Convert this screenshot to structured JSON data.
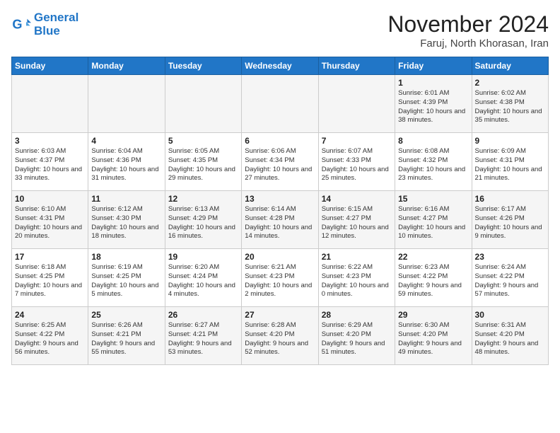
{
  "header": {
    "logo_line1": "General",
    "logo_line2": "Blue",
    "month_year": "November 2024",
    "location": "Faruj, North Khorasan, Iran"
  },
  "days_of_week": [
    "Sunday",
    "Monday",
    "Tuesday",
    "Wednesday",
    "Thursday",
    "Friday",
    "Saturday"
  ],
  "weeks": [
    [
      {
        "num": "",
        "info": ""
      },
      {
        "num": "",
        "info": ""
      },
      {
        "num": "",
        "info": ""
      },
      {
        "num": "",
        "info": ""
      },
      {
        "num": "",
        "info": ""
      },
      {
        "num": "1",
        "info": "Sunrise: 6:01 AM\nSunset: 4:39 PM\nDaylight: 10 hours and 38 minutes."
      },
      {
        "num": "2",
        "info": "Sunrise: 6:02 AM\nSunset: 4:38 PM\nDaylight: 10 hours and 35 minutes."
      }
    ],
    [
      {
        "num": "3",
        "info": "Sunrise: 6:03 AM\nSunset: 4:37 PM\nDaylight: 10 hours and 33 minutes."
      },
      {
        "num": "4",
        "info": "Sunrise: 6:04 AM\nSunset: 4:36 PM\nDaylight: 10 hours and 31 minutes."
      },
      {
        "num": "5",
        "info": "Sunrise: 6:05 AM\nSunset: 4:35 PM\nDaylight: 10 hours and 29 minutes."
      },
      {
        "num": "6",
        "info": "Sunrise: 6:06 AM\nSunset: 4:34 PM\nDaylight: 10 hours and 27 minutes."
      },
      {
        "num": "7",
        "info": "Sunrise: 6:07 AM\nSunset: 4:33 PM\nDaylight: 10 hours and 25 minutes."
      },
      {
        "num": "8",
        "info": "Sunrise: 6:08 AM\nSunset: 4:32 PM\nDaylight: 10 hours and 23 minutes."
      },
      {
        "num": "9",
        "info": "Sunrise: 6:09 AM\nSunset: 4:31 PM\nDaylight: 10 hours and 21 minutes."
      }
    ],
    [
      {
        "num": "10",
        "info": "Sunrise: 6:10 AM\nSunset: 4:31 PM\nDaylight: 10 hours and 20 minutes."
      },
      {
        "num": "11",
        "info": "Sunrise: 6:12 AM\nSunset: 4:30 PM\nDaylight: 10 hours and 18 minutes."
      },
      {
        "num": "12",
        "info": "Sunrise: 6:13 AM\nSunset: 4:29 PM\nDaylight: 10 hours and 16 minutes."
      },
      {
        "num": "13",
        "info": "Sunrise: 6:14 AM\nSunset: 4:28 PM\nDaylight: 10 hours and 14 minutes."
      },
      {
        "num": "14",
        "info": "Sunrise: 6:15 AM\nSunset: 4:27 PM\nDaylight: 10 hours and 12 minutes."
      },
      {
        "num": "15",
        "info": "Sunrise: 6:16 AM\nSunset: 4:27 PM\nDaylight: 10 hours and 10 minutes."
      },
      {
        "num": "16",
        "info": "Sunrise: 6:17 AM\nSunset: 4:26 PM\nDaylight: 10 hours and 9 minutes."
      }
    ],
    [
      {
        "num": "17",
        "info": "Sunrise: 6:18 AM\nSunset: 4:25 PM\nDaylight: 10 hours and 7 minutes."
      },
      {
        "num": "18",
        "info": "Sunrise: 6:19 AM\nSunset: 4:25 PM\nDaylight: 10 hours and 5 minutes."
      },
      {
        "num": "19",
        "info": "Sunrise: 6:20 AM\nSunset: 4:24 PM\nDaylight: 10 hours and 4 minutes."
      },
      {
        "num": "20",
        "info": "Sunrise: 6:21 AM\nSunset: 4:23 PM\nDaylight: 10 hours and 2 minutes."
      },
      {
        "num": "21",
        "info": "Sunrise: 6:22 AM\nSunset: 4:23 PM\nDaylight: 10 hours and 0 minutes."
      },
      {
        "num": "22",
        "info": "Sunrise: 6:23 AM\nSunset: 4:22 PM\nDaylight: 9 hours and 59 minutes."
      },
      {
        "num": "23",
        "info": "Sunrise: 6:24 AM\nSunset: 4:22 PM\nDaylight: 9 hours and 57 minutes."
      }
    ],
    [
      {
        "num": "24",
        "info": "Sunrise: 6:25 AM\nSunset: 4:22 PM\nDaylight: 9 hours and 56 minutes."
      },
      {
        "num": "25",
        "info": "Sunrise: 6:26 AM\nSunset: 4:21 PM\nDaylight: 9 hours and 55 minutes."
      },
      {
        "num": "26",
        "info": "Sunrise: 6:27 AM\nSunset: 4:21 PM\nDaylight: 9 hours and 53 minutes."
      },
      {
        "num": "27",
        "info": "Sunrise: 6:28 AM\nSunset: 4:20 PM\nDaylight: 9 hours and 52 minutes."
      },
      {
        "num": "28",
        "info": "Sunrise: 6:29 AM\nSunset: 4:20 PM\nDaylight: 9 hours and 51 minutes."
      },
      {
        "num": "29",
        "info": "Sunrise: 6:30 AM\nSunset: 4:20 PM\nDaylight: 9 hours and 49 minutes."
      },
      {
        "num": "30",
        "info": "Sunrise: 6:31 AM\nSunset: 4:20 PM\nDaylight: 9 hours and 48 minutes."
      }
    ]
  ]
}
